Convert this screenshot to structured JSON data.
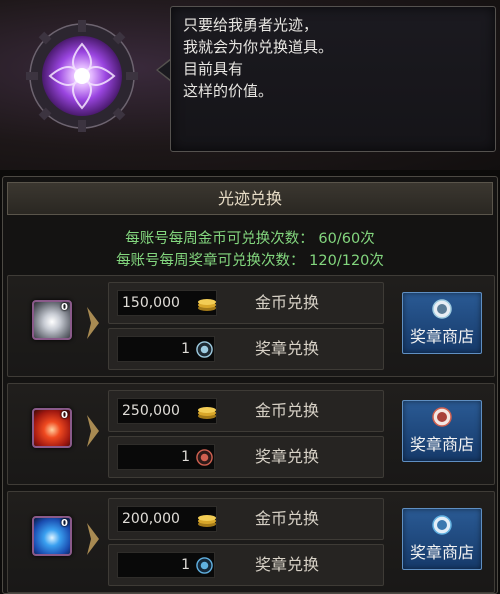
{
  "npc": {
    "dialog_lines": [
      "只要给我勇者光迹，",
      "我就会为你兑换道具。",
      "目前具有",
      "这样的价值。"
    ]
  },
  "panel": {
    "title": "光迹兑换",
    "gold_quota_label": "每账号每周金币可兑换次数：",
    "gold_quota_value": "60/60次",
    "medal_quota_label": "每账号每周奖章可兑换次数：",
    "medal_quota_value": "120/120次"
  },
  "rows": [
    {
      "item_color": "silver",
      "item_count": "0",
      "gold_amount": "150,000",
      "gold_label": "金币兑换",
      "medal_amount": "1",
      "medal_label": "奖章兑换",
      "medal_color": "#9ecbe0",
      "shop_label": "奖章商店"
    },
    {
      "item_color": "red",
      "item_count": "0",
      "gold_amount": "250,000",
      "gold_label": "金币兑换",
      "medal_amount": "1",
      "medal_label": "奖章兑换",
      "medal_color": "#d06050",
      "shop_label": "奖章商店"
    },
    {
      "item_color": "blue",
      "item_count": "0",
      "gold_amount": "200,000",
      "gold_label": "金币兑换",
      "medal_amount": "1",
      "medal_label": "奖章兑换",
      "medal_color": "#60b0e0",
      "shop_label": "奖章商店"
    }
  ],
  "colors": {
    "quota_text": "#83d67e",
    "shop_button": "#1f4a80",
    "emblem_glow": "#b86cff"
  },
  "icons": {
    "emblem": "purple-gear-emblem-icon",
    "coin": "gold-coin-stack-icon",
    "medal": "medal-icon"
  }
}
